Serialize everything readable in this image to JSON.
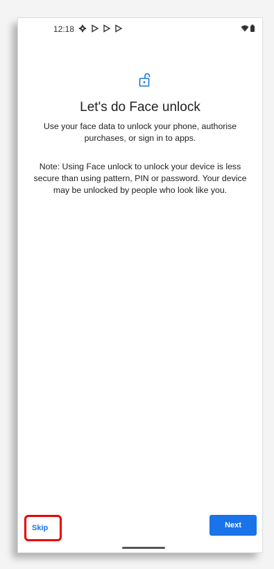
{
  "status_bar": {
    "time": "12:18",
    "icons_left": [
      "settings-icon",
      "play-store-icon",
      "play-store-icon",
      "play-store-icon"
    ],
    "icons_right": [
      "wifi-icon",
      "battery-icon"
    ]
  },
  "header": {
    "icon": "unlocked-padlock-icon",
    "accent_color": "#1a73e8"
  },
  "content": {
    "title": "Let's do Face unlock",
    "subtitle": "Use your face data to unlock your phone, authorise purchases, or sign in to apps.",
    "note": "Note: Using Face unlock to unlock your device is less secure than using pattern, PIN or password. Your device may be unlocked by people who look like you."
  },
  "footer": {
    "skip_label": "Skip",
    "next_label": "Next",
    "highlight_color": "#ea0000"
  }
}
